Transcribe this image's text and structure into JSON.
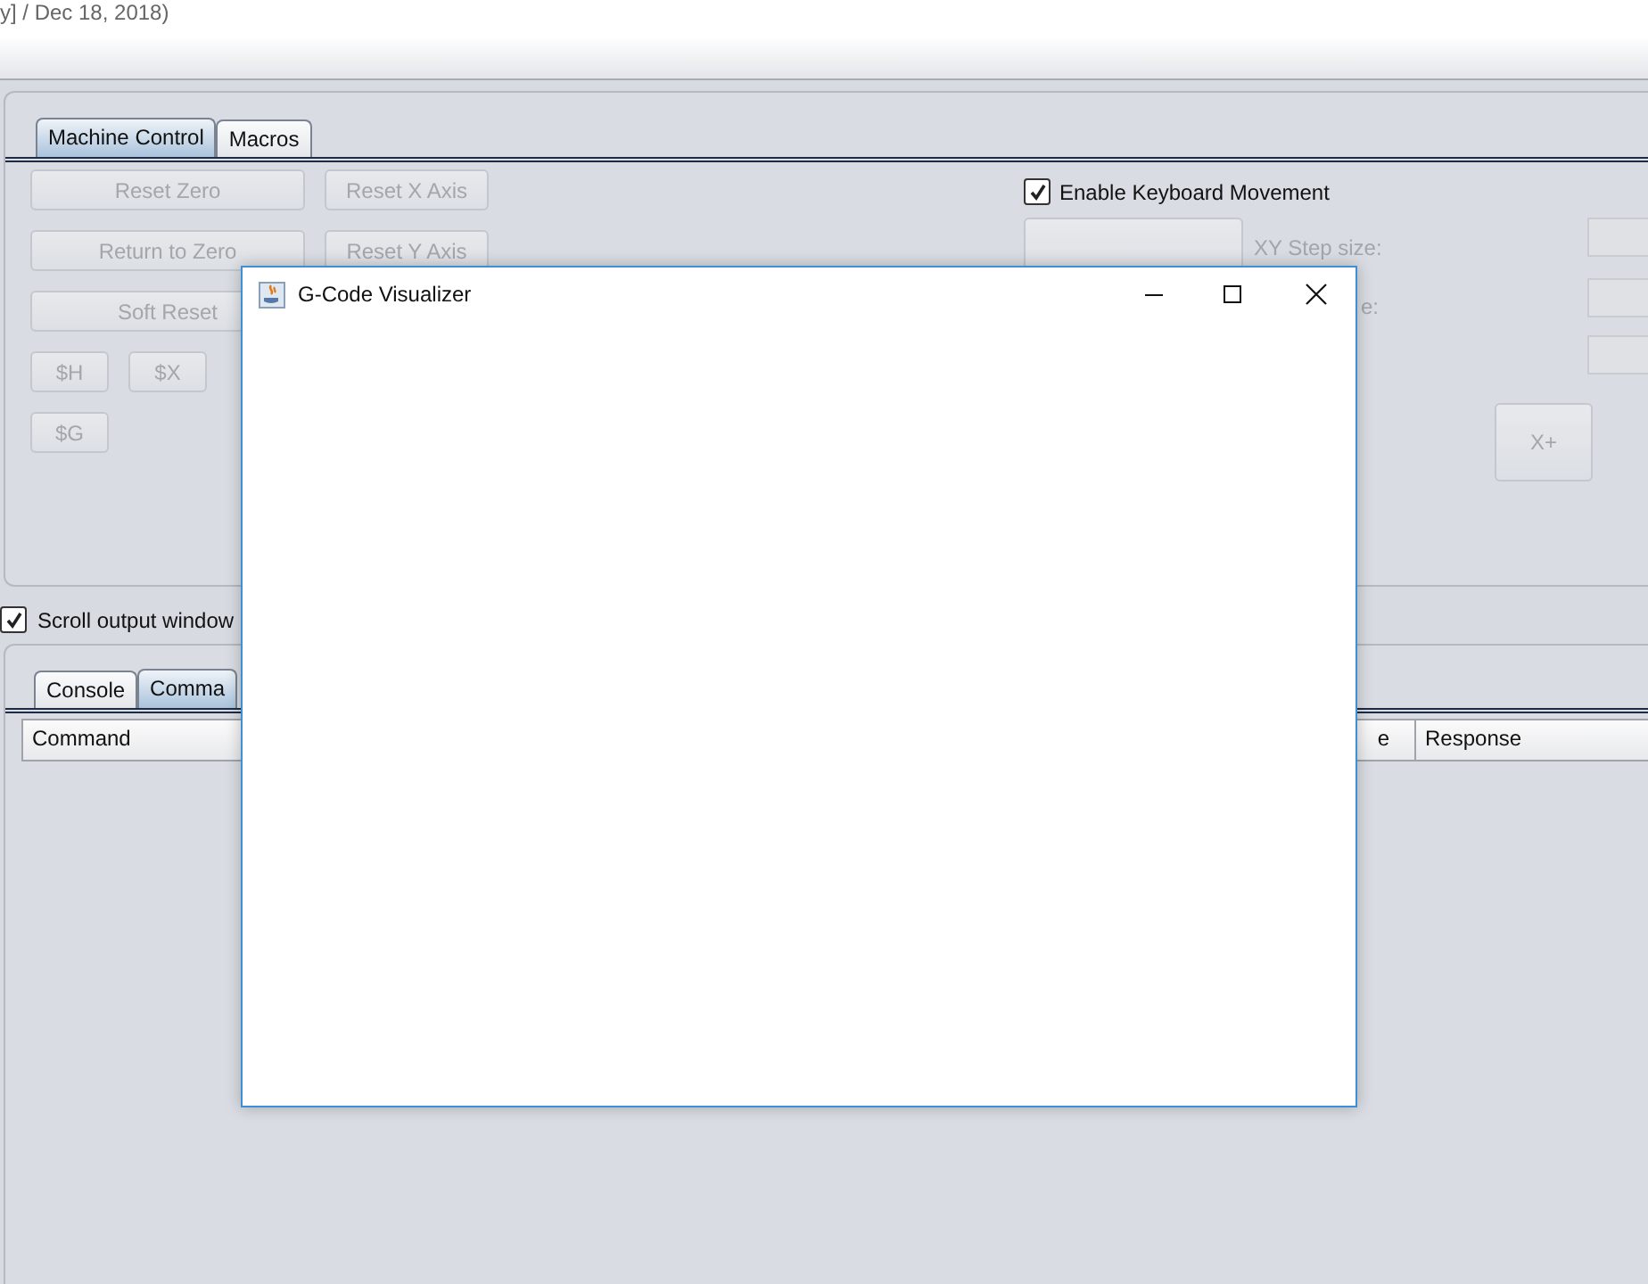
{
  "header": {
    "title_fragment": "y]  / Dec 18, 2018)"
  },
  "control_panel": {
    "tabs": [
      {
        "label": "Machine Control",
        "selected": true
      },
      {
        "label": "Macros",
        "selected": false
      }
    ],
    "button_rows": [
      [
        {
          "label": "Reset Zero",
          "kind": "wide",
          "disabled": true
        },
        {
          "label": "Reset X Axis",
          "kind": "medium",
          "disabled": true
        }
      ],
      [
        {
          "label": "Return to Zero",
          "kind": "wide",
          "disabled": true
        },
        {
          "label": "Reset Y Axis",
          "kind": "medium",
          "disabled": true
        }
      ],
      [
        {
          "label": "Soft Reset",
          "kind": "wide",
          "disabled": true
        }
      ],
      [
        {
          "label": "$H",
          "kind": "small",
          "disabled": true
        },
        {
          "label": "$X",
          "kind": "small",
          "disabled": true
        }
      ],
      [
        {
          "label": "$G",
          "kind": "small",
          "disabled": true
        }
      ]
    ],
    "keyboard_movement": {
      "label": "Enable Keyboard Movement",
      "checked": true
    },
    "step_labels": [
      "XY Step size:",
      "e:"
    ],
    "jog_button": {
      "label": "X+",
      "disabled": true
    }
  },
  "scroll_output": {
    "label": "Scroll output window",
    "checked": true
  },
  "output_panel": {
    "tabs": [
      {
        "label": "Console",
        "selected": false
      },
      {
        "label": "Comma",
        "selected": true
      }
    ],
    "table": {
      "columns": [
        "Command",
        "e",
        "Response"
      ]
    }
  },
  "dialog": {
    "title": "G-Code Visualizer"
  }
}
